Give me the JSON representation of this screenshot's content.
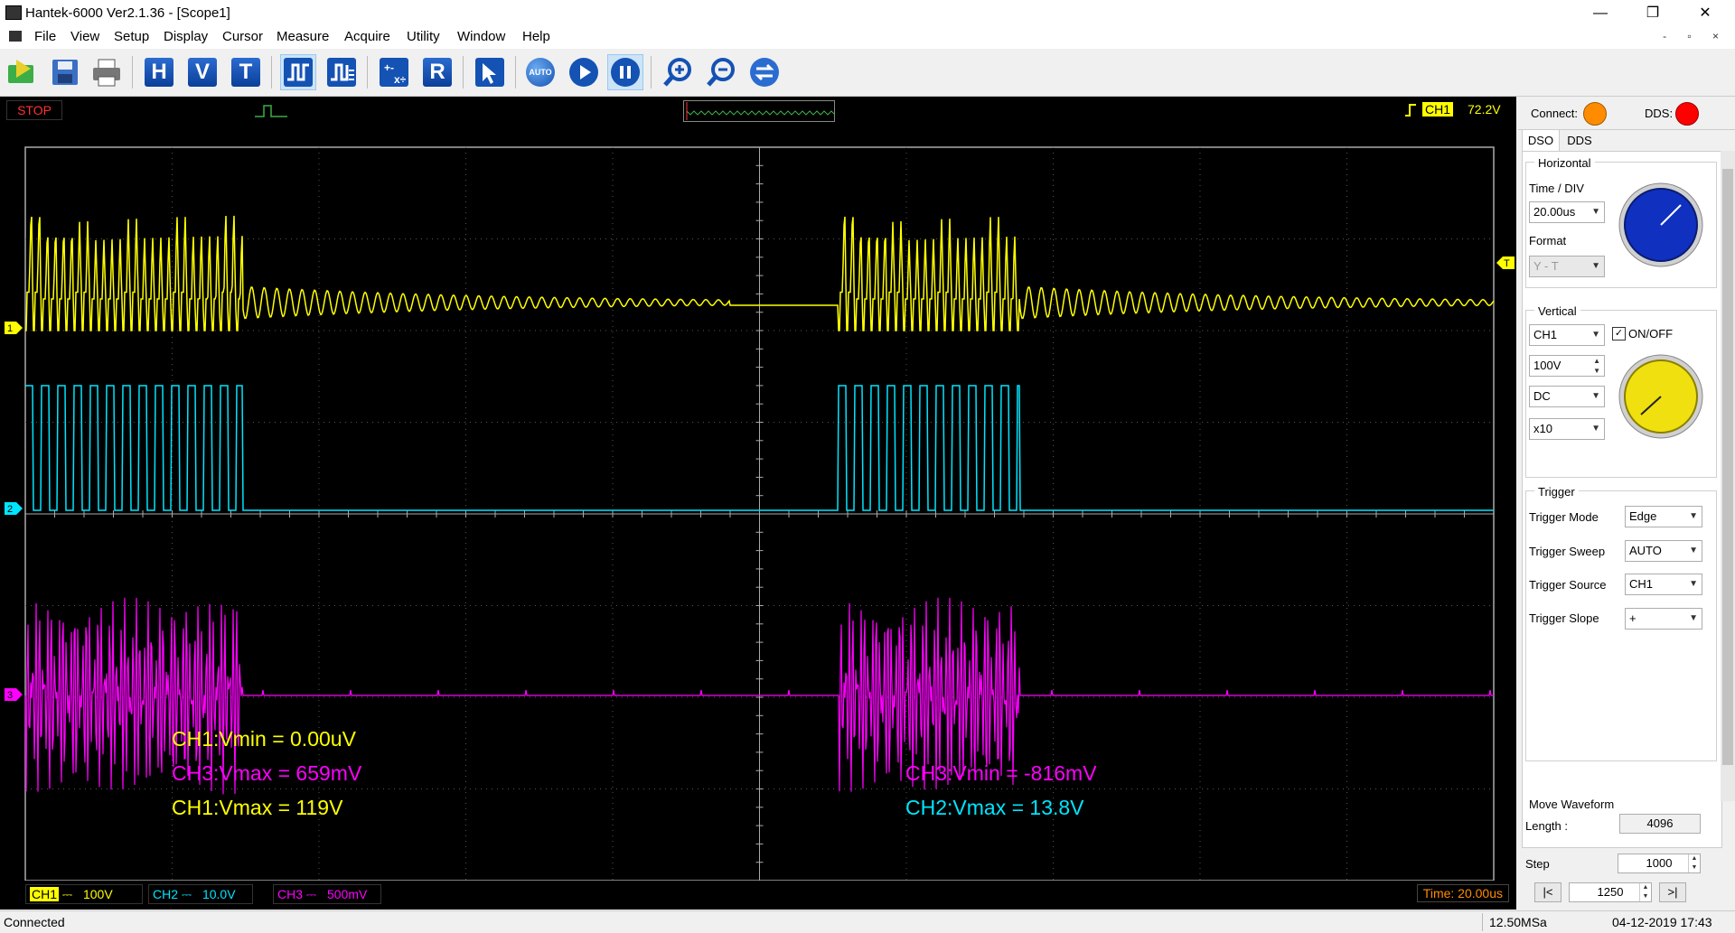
{
  "window": {
    "title": "Hantek-6000 Ver2.1.36 - [Scope1]",
    "minimize": "—",
    "restore": "❐",
    "close": "✕"
  },
  "menu": [
    "File",
    "View",
    "Setup",
    "Display",
    "Cursor",
    "Measure",
    "Acquire",
    "Utility",
    "Window",
    "Help"
  ],
  "mdi_controls": "- ▫ ×",
  "toolbar": {
    "h": "H",
    "v": "V",
    "t": "T",
    "r": "R",
    "auto": "AUTO"
  },
  "scope": {
    "state": "STOP",
    "trigger_channel": "CH1",
    "trigger_level": "72.2V",
    "time_div": "Time: 20.00us",
    "channels": [
      {
        "name": "CH1",
        "scale": "100V",
        "color": "#ffff00",
        "marker": "1"
      },
      {
        "name": "CH2",
        "scale": "10.0V",
        "color": "#00e5ff",
        "marker": "2"
      },
      {
        "name": "CH3",
        "scale": "500mV",
        "color": "#ff00ff",
        "marker": "3"
      }
    ],
    "trigger_marker": "T",
    "measurements": [
      {
        "text": "CH1:Vmin = 0.00uV",
        "color": "#ffff00"
      },
      {
        "text": "CH3:Vmax = 659mV",
        "color": "#ff00ff"
      },
      {
        "text": "CH1:Vmax = 119V",
        "color": "#ffff00"
      },
      {
        "text": "CH3:Vmin = -816mV",
        "color": "#ff00ff"
      },
      {
        "text": "CH2:Vmax = 13.8V",
        "color": "#00e5ff"
      }
    ]
  },
  "panel": {
    "connect_label": "Connect:",
    "connect_color": "#ff8c00",
    "dds_label": "DDS:",
    "dds_color": "#ff0000",
    "tabs": [
      "DSO",
      "DDS"
    ],
    "horizontal": {
      "title": "Horizontal",
      "time_div_label": "Time / DIV",
      "time_div_value": "20.00us",
      "format_label": "Format",
      "format_value": "Y - T"
    },
    "vertical": {
      "title": "Vertical",
      "channel": "CH1",
      "onoff": "ON/OFF",
      "volts": "100V",
      "coupling": "DC",
      "probe": "x10"
    },
    "trigger": {
      "title": "Trigger",
      "mode_label": "Trigger Mode",
      "mode": "Edge",
      "sweep_label": "Trigger Sweep",
      "sweep": "AUTO",
      "source_label": "Trigger Source",
      "source": "CH1",
      "slope_label": "Trigger Slope",
      "slope": "+"
    },
    "move": {
      "title": "Move Waveform",
      "length_label": "Length :",
      "length": "4096",
      "step_label": "Step",
      "step": "1000",
      "position": "1250",
      "first": "|<",
      "last": ">|"
    }
  },
  "statusbar": {
    "left": "Connected",
    "rate": "12.50MSa",
    "datetime": "04-12-2019  17:43"
  }
}
